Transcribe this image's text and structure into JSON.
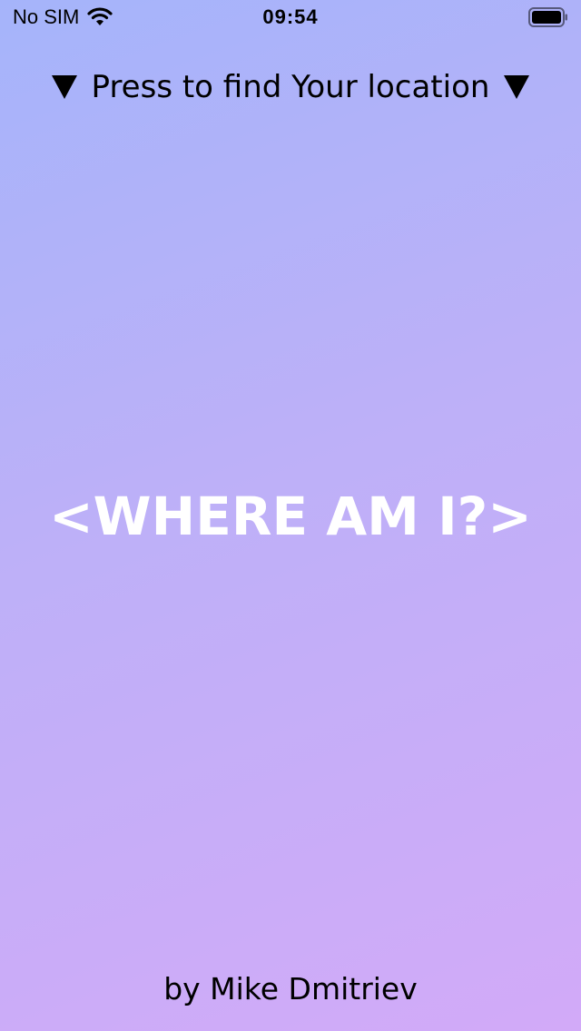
{
  "status_bar": {
    "carrier": "No SIM",
    "time": "09:54",
    "wifi_icon": "wifi-icon",
    "battery_icon": "battery-icon"
  },
  "find_button": {
    "label": "Press to find Your location",
    "left_icon": "triangle-down-icon",
    "right_icon": "triangle-down-icon"
  },
  "title": "<WHERE AM I?>",
  "author": "by Mike Dmitriev",
  "colors": {
    "background_top": "#a5b4fa",
    "background_bottom": "#d2aaf8",
    "title_text": "#ffffff",
    "text": "#000000"
  }
}
